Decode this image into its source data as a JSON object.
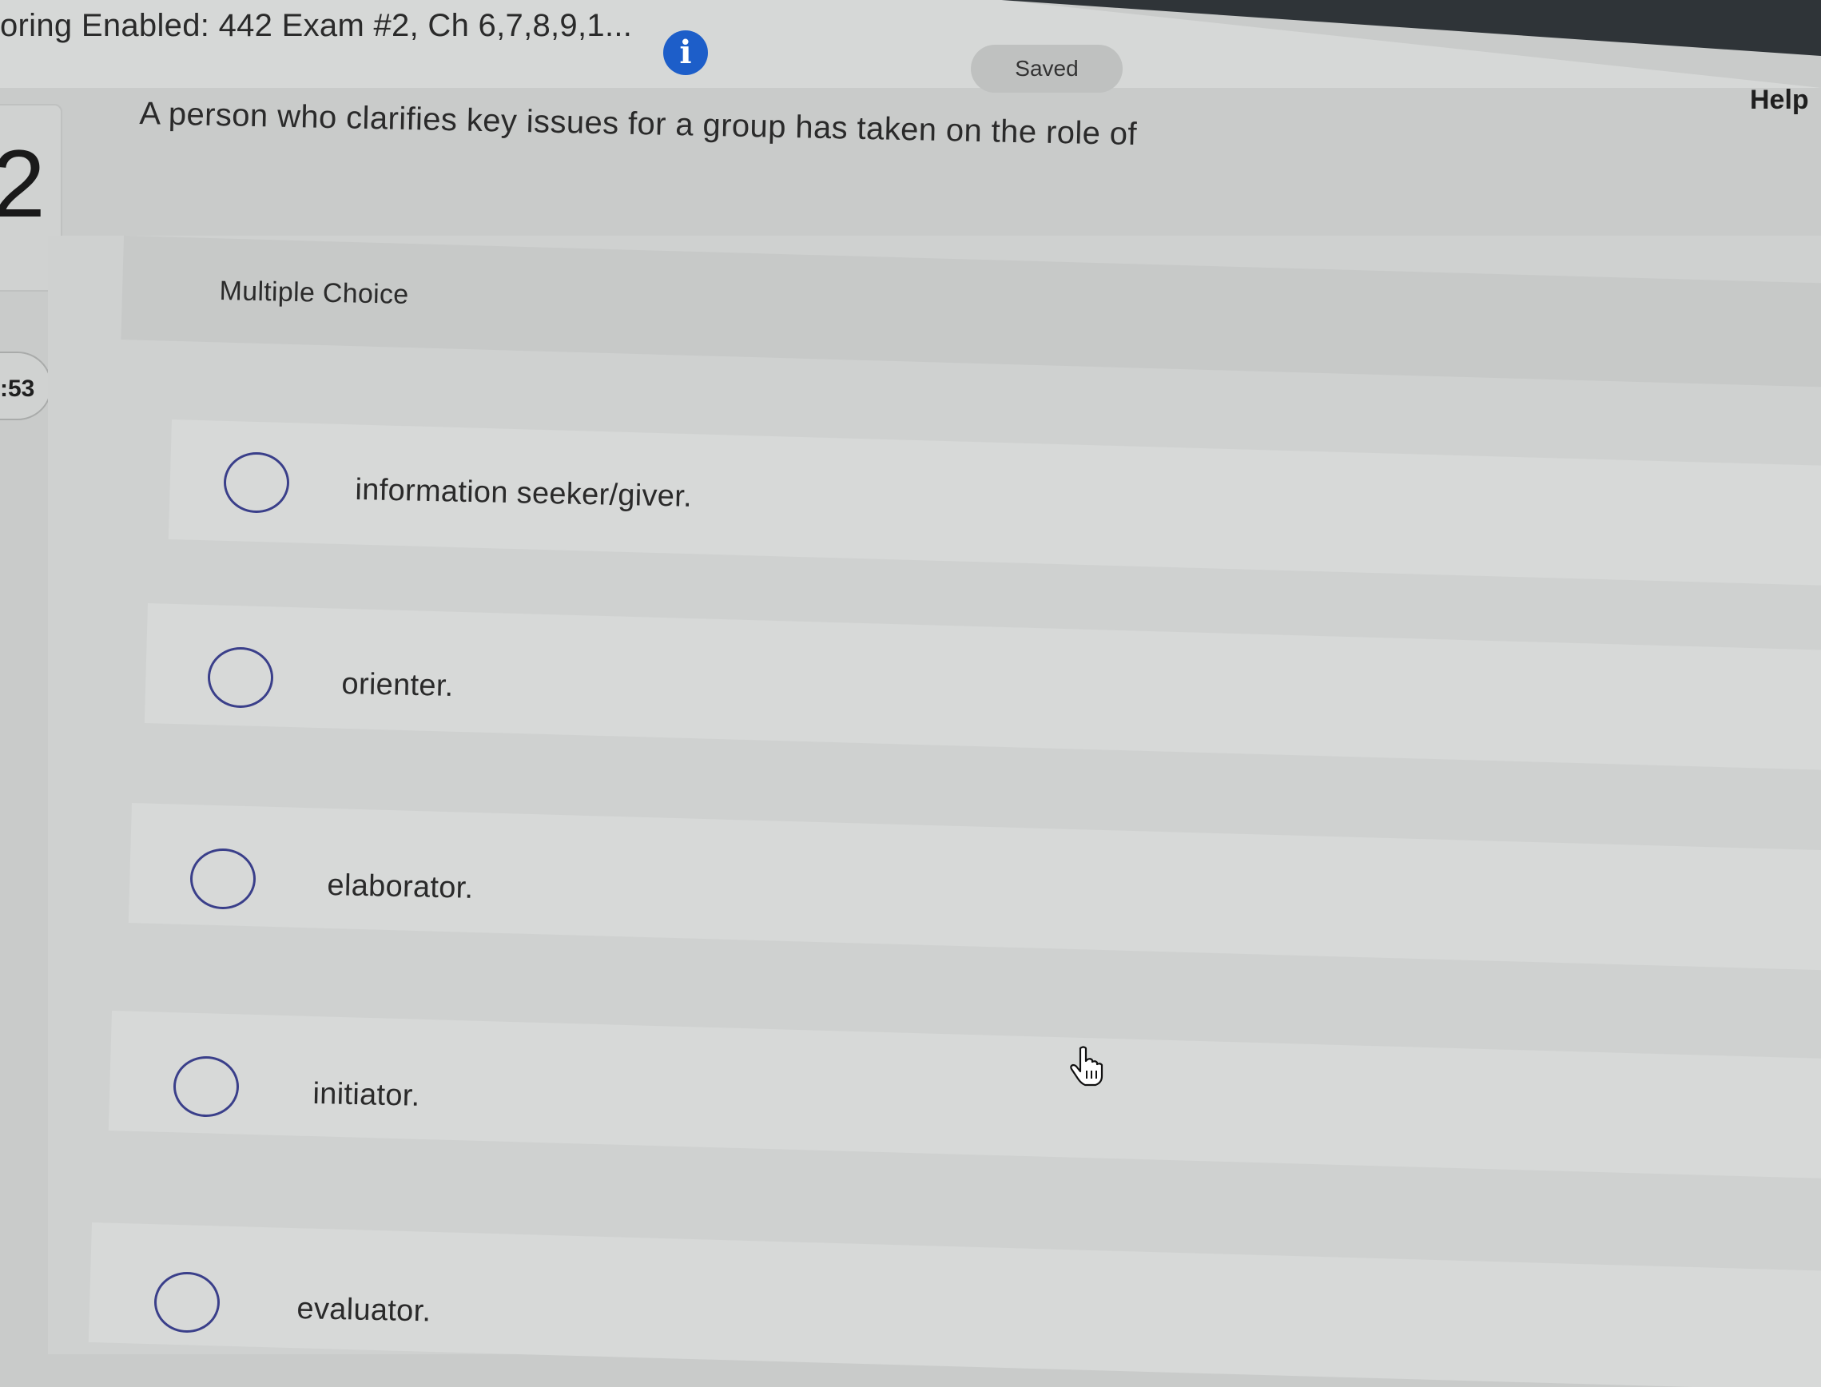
{
  "header": {
    "exam_title": "oring Enabled: 442 Exam #2, Ch 6,7,8,9,1...",
    "info_glyph": "i",
    "saved_label": "Saved",
    "help_label": "Help"
  },
  "left_rail": {
    "question_number": "2",
    "timer": ":53"
  },
  "question": {
    "text": "A person who clarifies key issues for a group has taken on the role of",
    "type_label": "Multiple Choice",
    "options": [
      {
        "label": "information seeker/giver.",
        "selected": false
      },
      {
        "label": "orienter.",
        "selected": false
      },
      {
        "label": "elaborator.",
        "selected": false
      },
      {
        "label": "initiator.",
        "selected": false
      },
      {
        "label": "evaluator.",
        "selected": false
      }
    ]
  },
  "colors": {
    "accent": "#1d5ec9",
    "radio_border": "#3a3f8a",
    "background": "#c9cbca"
  },
  "icons": {
    "info": "info-icon",
    "cursor": "hand-pointer-icon"
  }
}
